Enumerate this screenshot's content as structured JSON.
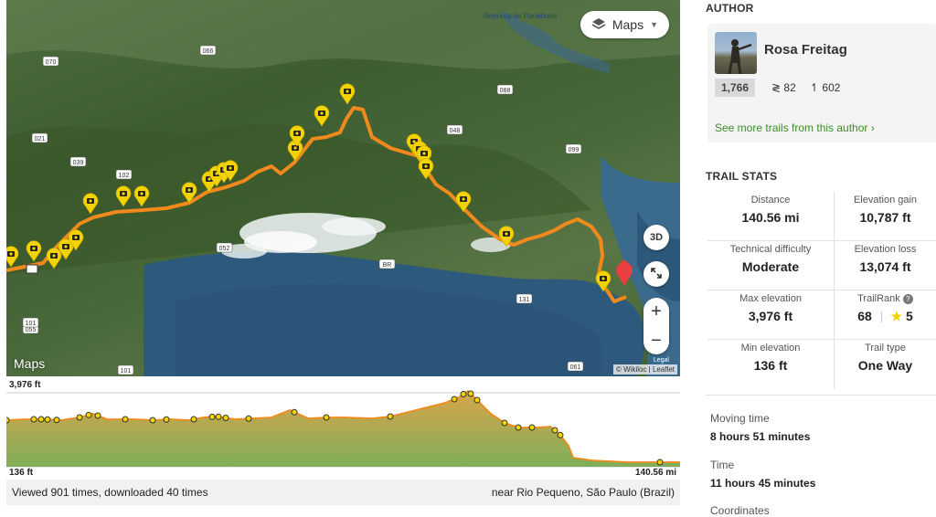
{
  "map": {
    "layer_button": "Maps",
    "btn_3d": "3D",
    "zoom_in": "+",
    "zoom_out": "−",
    "brand": "Maps",
    "legal": "Legal",
    "credit": "© Wikiloc | Leaflet",
    "place_label": "Represa de Paraibuna",
    "road_labels": [
      "070",
      "066",
      "021",
      "039",
      "102",
      "052",
      "048",
      "088",
      "099",
      "099",
      "055",
      "101",
      "061",
      "131",
      "101",
      "BR"
    ]
  },
  "elevation": {
    "top_label": "3,976 ft",
    "bottom_label": "136 ft",
    "end_label": "140.56 mi"
  },
  "footer": {
    "views": "Viewed 901 times, downloaded 40 times",
    "location": "near Rio Pequeno, São Paulo (Brazil)"
  },
  "author": {
    "section_title": "AUTHOR",
    "name": "Rosa Freitag",
    "rank": "1,766",
    "trails": "82",
    "followers": "602",
    "more_link": "See more trails from this author ›"
  },
  "trail_stats": {
    "section_title": "TRAIL STATS",
    "distance_label": "Distance",
    "distance": "140.56 mi",
    "gain_label": "Elevation gain",
    "gain": "10,787 ft",
    "difficulty_label": "Technical difficulty",
    "difficulty": "Moderate",
    "loss_label": "Elevation loss",
    "loss": "13,074 ft",
    "max_label": "Max elevation",
    "max": "3,976 ft",
    "trailrank_label": "TrailRank",
    "trailrank": "68",
    "stars": "5",
    "min_label": "Min elevation",
    "min": "136 ft",
    "type_label": "Trail type",
    "type": "One Way"
  },
  "details": {
    "moving_label": "Moving time",
    "moving": "8 hours 51 minutes",
    "time_label": "Time",
    "time": "11 hours 45 minutes",
    "coords_label": "Coordinates"
  },
  "colors": {
    "track": "#f08a1c",
    "marker": "#f2d300",
    "accent": "#3a8c28",
    "end_pin": "#e84040"
  }
}
